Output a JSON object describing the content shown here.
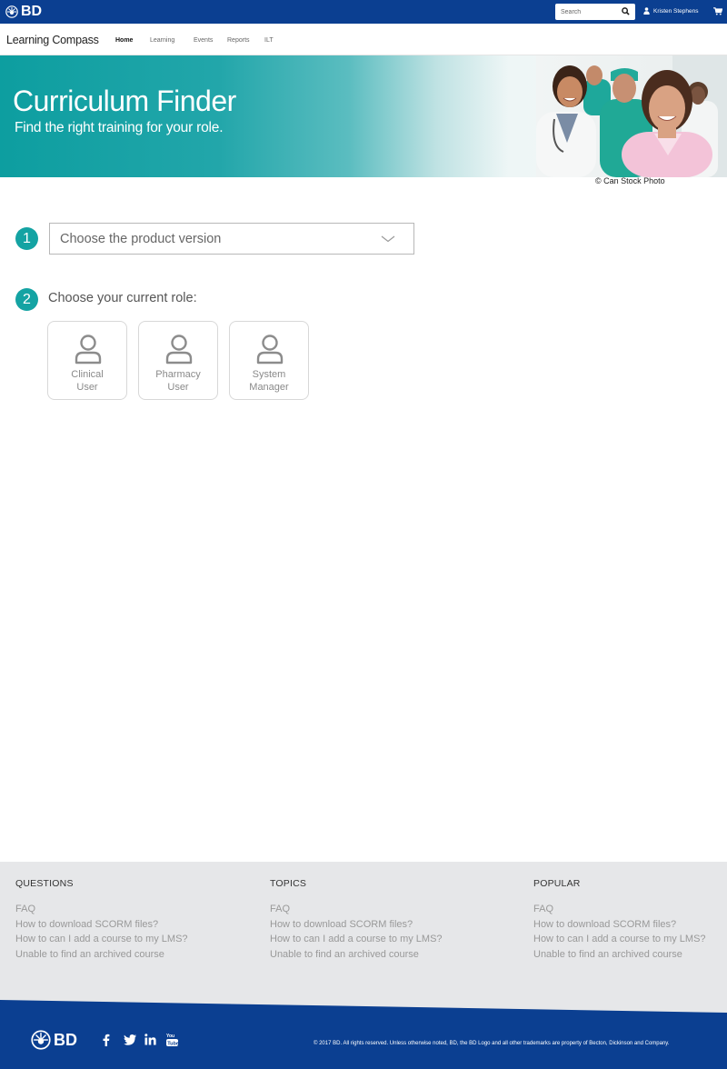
{
  "topbar": {
    "logo_text": "BD",
    "search_placeholder": "Search",
    "user_name": "Kristen Stephens"
  },
  "nav": {
    "brand": "Learning Compass",
    "items": [
      {
        "label": "Home",
        "active": true
      },
      {
        "label": "Learning"
      },
      {
        "label": "Events"
      },
      {
        "label": "Reports"
      },
      {
        "label": "ILT"
      }
    ]
  },
  "hero": {
    "title": "Curriculum Finder",
    "subtitle": "Find the right training for your role.",
    "photo_credit": "© Can Stock Photo"
  },
  "steps": {
    "step1": {
      "number": "1",
      "select_value": "Choose the product version"
    },
    "step2": {
      "number": "2",
      "label": "Choose your current role:"
    },
    "roles": [
      {
        "line1": "Clinical",
        "line2": "User"
      },
      {
        "line1": "Pharmacy",
        "line2": "User"
      },
      {
        "line1": "System",
        "line2": "Manager"
      }
    ]
  },
  "footer": {
    "columns": [
      {
        "heading": "QUESTIONS",
        "links": [
          "FAQ",
          "How to download SCORM files?",
          "How to can I add a course to my LMS?",
          "Unable to find an archived course"
        ]
      },
      {
        "heading": "TOPICS",
        "links": [
          "FAQ",
          "How to download SCORM files?",
          "How to can I add a course to my LMS?",
          "Unable to find an archived course"
        ]
      },
      {
        "heading": "POPULAR",
        "links": [
          "FAQ",
          "How to download SCORM files?",
          "How to can I add a course to my LMS?",
          "Unable to find an archived course"
        ]
      }
    ],
    "logo_text": "BD",
    "copyright": "© 2017 BD. All rights reserved. Unless otherwise noted, BD, the BD Logo and all other trademarks are property of Becton, Dickinson and Company."
  },
  "colors": {
    "brand_blue": "#0b3f91",
    "teal": "#14a3a3",
    "footer_gray": "#e6e7e9"
  }
}
